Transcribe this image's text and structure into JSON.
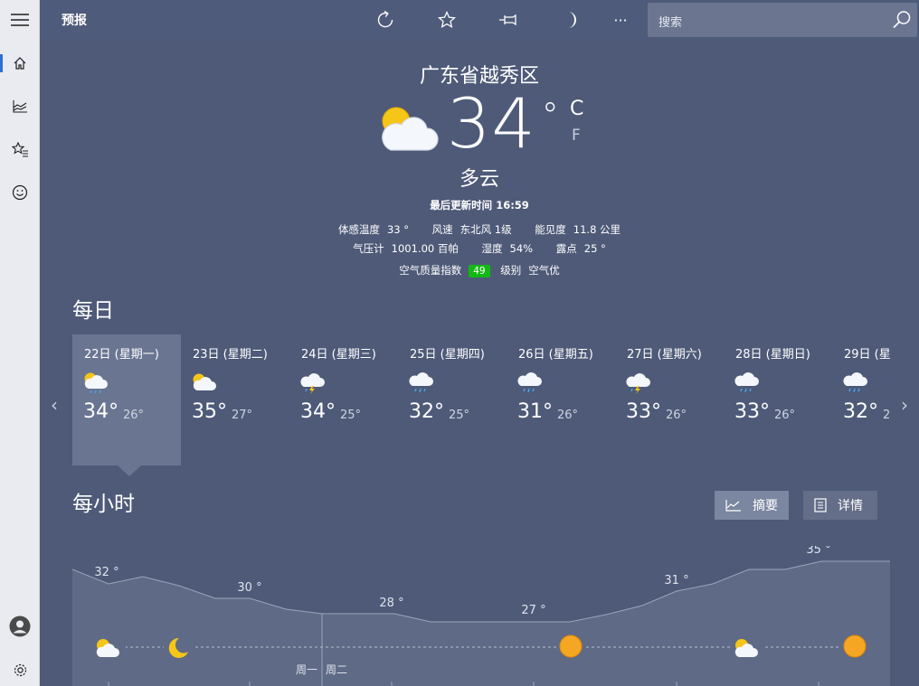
{
  "app": {
    "title": "预报"
  },
  "search": {
    "placeholder": "搜索"
  },
  "current": {
    "location": "广东省越秀区",
    "temp": "34",
    "degree": "°",
    "unit_c": "C",
    "unit_f": "F",
    "condition": "多云",
    "updated": "最后更新时间 16:59",
    "feels_like_label": "体感温度",
    "feels_like": "33 °",
    "wind_label": "风速",
    "wind": "东北风 1级",
    "visibility_label": "能见度",
    "visibility": "11.8 公里",
    "pressure_label": "气压计",
    "pressure": "1001.00 百帕",
    "humidity_label": "湿度",
    "humidity": "54%",
    "dewpoint_label": "露点",
    "dewpoint": "25 °",
    "aqi_label": "空气质量指数",
    "aqi": "49",
    "aqi_color": "#14b814",
    "level_label": "级别",
    "level": "空气优"
  },
  "daily": {
    "title": "每日",
    "days": [
      {
        "label": "22日 (星期一)",
        "hi": "34°",
        "lo": "26°",
        "icon": "partly-cloudy-rain-icon"
      },
      {
        "label": "23日 (星期二)",
        "hi": "35°",
        "lo": "27°",
        "icon": "partly-cloudy-icon"
      },
      {
        "label": "24日 (星期三)",
        "hi": "34°",
        "lo": "25°",
        "icon": "thunderstorm-icon"
      },
      {
        "label": "25日 (星期四)",
        "hi": "32°",
        "lo": "25°",
        "icon": "rain-icon"
      },
      {
        "label": "26日 (星期五)",
        "hi": "31°",
        "lo": "26°",
        "icon": "rain-icon"
      },
      {
        "label": "27日 (星期六)",
        "hi": "33°",
        "lo": "26°",
        "icon": "thunderstorm-icon"
      },
      {
        "label": "28日 (星期日)",
        "hi": "33°",
        "lo": "26°",
        "icon": "rain-icon"
      },
      {
        "label": "29日 (星期",
        "hi": "32°",
        "lo": "2",
        "icon": "rain-icon"
      }
    ]
  },
  "hourly": {
    "title": "每小时",
    "summary_label": "摘要",
    "details_label": "详情",
    "temps": [
      "32 °",
      "30 °",
      "28 °",
      "27 °",
      "31 °",
      "35 °"
    ],
    "day_labels": [
      "周一",
      "周二"
    ],
    "icons": [
      "partly-cloudy-icon",
      "moon-icon",
      "sun-icon",
      "partly-cloudy-icon",
      "sun-icon"
    ]
  },
  "colors": {
    "background": "#4e5a78",
    "selected_day": "#6a7592",
    "nav_accent": "#2f6fd4"
  }
}
